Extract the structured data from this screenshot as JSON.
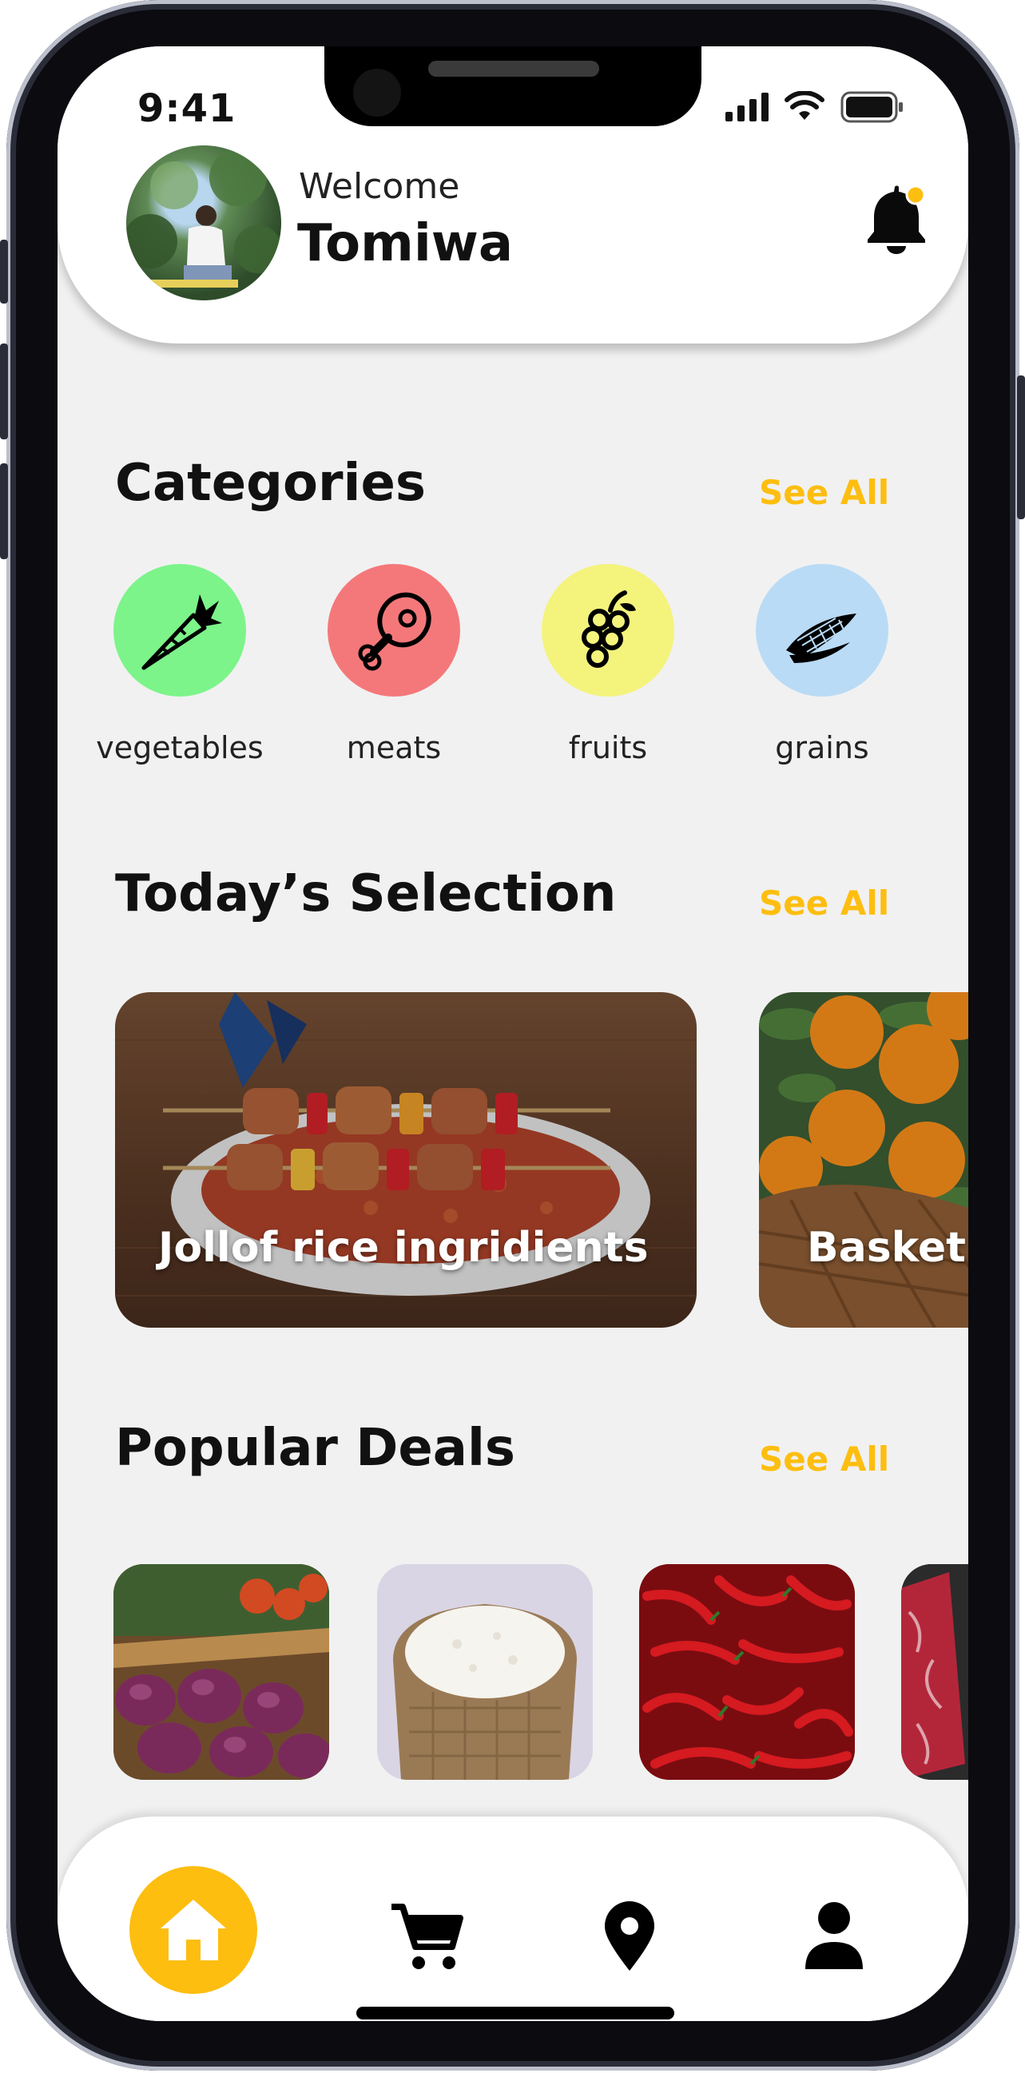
{
  "status_bar": {
    "time": "9:41"
  },
  "header": {
    "greeting": "Welcome",
    "user_name": "Tomiwa",
    "icons": {
      "avatar": "user-photo",
      "notification": "bell-icon",
      "badge_color": "#FDBE10"
    }
  },
  "categories": {
    "title": "Categories",
    "see_all": "See All",
    "items": [
      {
        "label": "vegetables",
        "icon": "carrot-icon",
        "color": "#7CF48A"
      },
      {
        "label": "meats",
        "icon": "meat-leg-icon",
        "color": "#F4787A"
      },
      {
        "label": "fruits",
        "icon": "grapes-icon",
        "color": "#F4F37C"
      },
      {
        "label": "grains",
        "icon": "corn-icon",
        "color": "#B9DBF6"
      }
    ]
  },
  "todays_selection": {
    "title": "Today’s Selection",
    "see_all": "See All",
    "cards": [
      {
        "label": "Jollof rice ingridients"
      },
      {
        "label": "Basket"
      }
    ]
  },
  "popular_deals": {
    "title": "Popular Deals",
    "see_all": "See All",
    "items": [
      {
        "name": "onions-image"
      },
      {
        "name": "rice-sack-image"
      },
      {
        "name": "red-peppers-image"
      },
      {
        "name": "raw-meat-image"
      }
    ]
  },
  "bottom_nav": {
    "items": [
      {
        "icon": "home-icon",
        "active": true
      },
      {
        "icon": "cart-icon",
        "active": false
      },
      {
        "icon": "location-pin-icon",
        "active": false
      },
      {
        "icon": "profile-icon",
        "active": false
      }
    ]
  },
  "colors": {
    "accent": "#FDBE10",
    "background": "#F1F1F1",
    "text": "#111111"
  }
}
